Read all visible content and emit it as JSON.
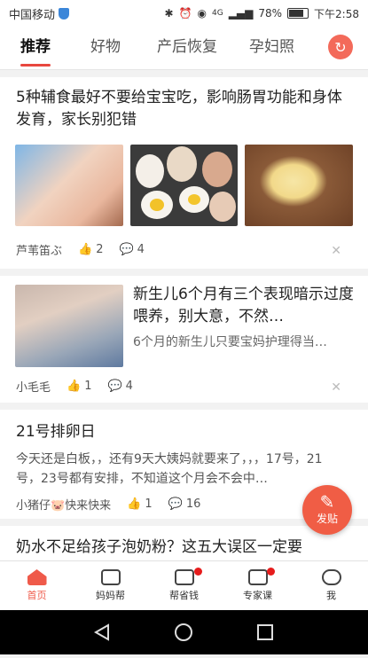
{
  "status_bar": {
    "carrier": "中国移动",
    "network": "4G",
    "battery": "78%",
    "time": "下午2:58"
  },
  "tabs": [
    {
      "label": "推荐",
      "active": true
    },
    {
      "label": "好物",
      "active": false
    },
    {
      "label": "产后恢复",
      "active": false
    },
    {
      "label": "孕妇照",
      "active": false
    }
  ],
  "articles": [
    {
      "title": "5种辅食最好不要给宝宝吃，影响肠胃功能和身体发育，家长别犯错",
      "author": "芦苇笛ぶ",
      "likes": "2",
      "comments": "4"
    },
    {
      "title": "新生儿6个月有三个表现暗示过度喂养，别大意，不然…",
      "summary": "6个月的新生儿只要宝妈护理得当…",
      "author": "小毛毛",
      "likes": "1",
      "comments": "4"
    },
    {
      "title": "21号排卵日",
      "summary": "今天还是白板，，还有9天大姨妈就要来了，，，17号，21号，23号都有安排，不知道这个月会不会中…",
      "author": "小猪仔🐷快来快来",
      "likes": "1",
      "comments": "16"
    },
    {
      "title": "奶水不足给孩子泡奶粉？这五大误区一定要"
    }
  ],
  "fab": {
    "label": "发贴"
  },
  "bottom_nav": [
    {
      "label": "首页",
      "active": true
    },
    {
      "label": "妈妈帮",
      "active": false
    },
    {
      "label": "帮省钱",
      "active": false
    },
    {
      "label": "专家课",
      "active": false
    },
    {
      "label": "我",
      "active": false
    }
  ],
  "colors": {
    "accent": "#ef5a4a",
    "badge": "#e61c1c"
  }
}
